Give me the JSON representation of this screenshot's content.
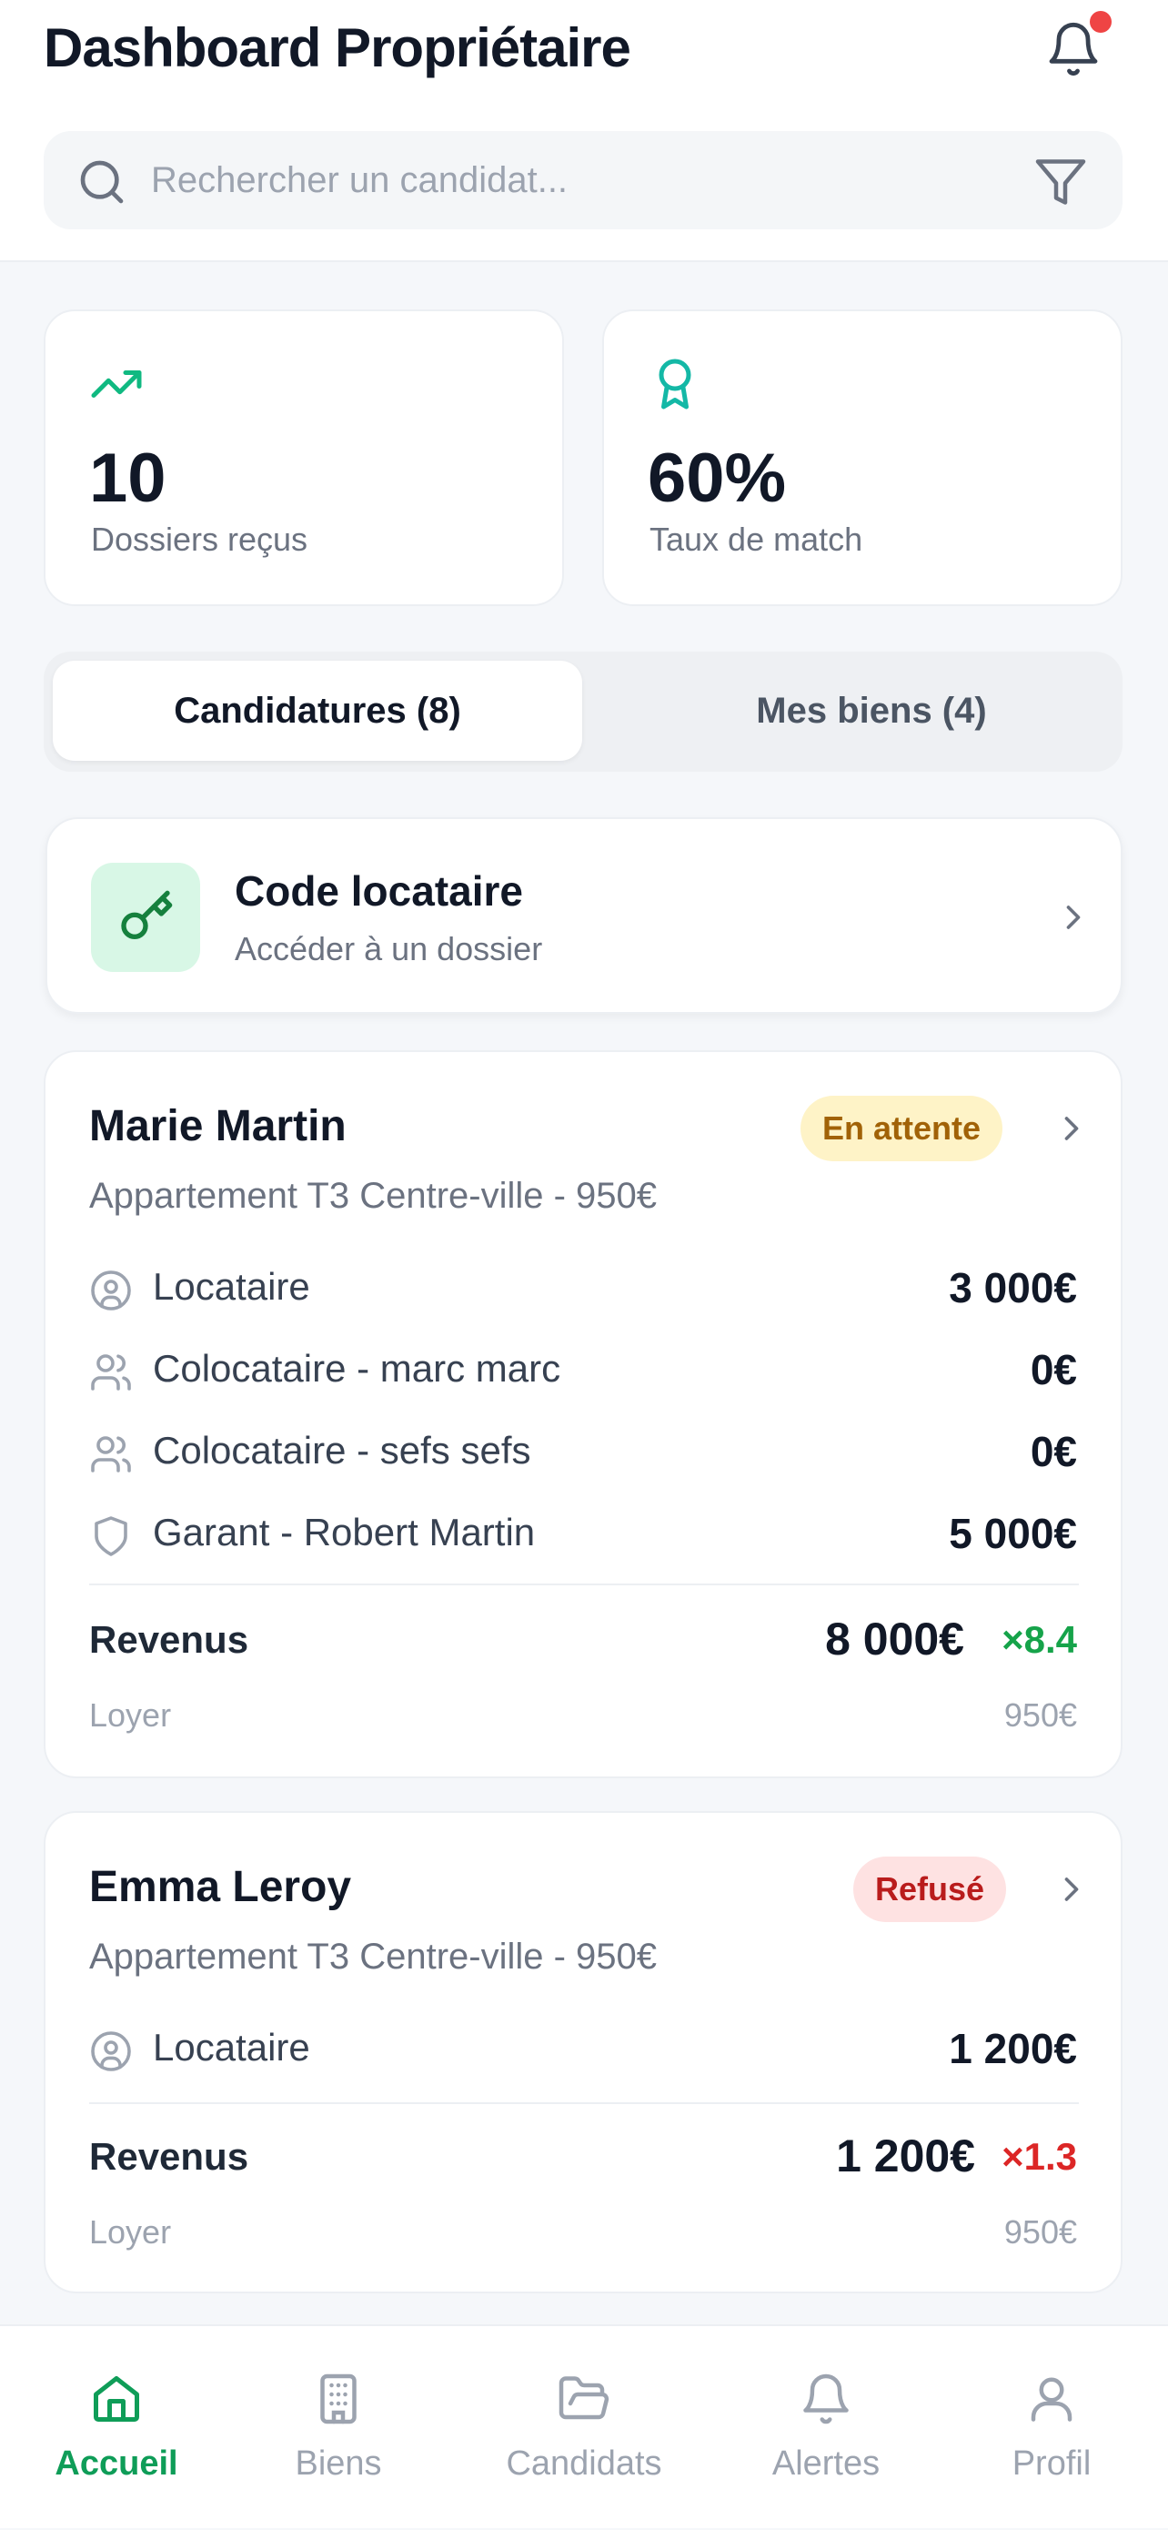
{
  "header": {
    "title": "Dashboard Propriétaire",
    "notification_icon": "bell-icon",
    "has_unread": true,
    "search_placeholder": "Rechercher un candidat...",
    "search_value": ""
  },
  "stats": [
    {
      "icon": "trending-up-icon",
      "value": "10",
      "label": "Dossiers reçus"
    },
    {
      "icon": "award-icon",
      "value": "60%",
      "label": "Taux de match"
    }
  ],
  "tabs": [
    {
      "label": "Candidatures (8)",
      "active": true
    },
    {
      "label": "Mes biens (4)",
      "active": false
    }
  ],
  "code_card": {
    "icon": "key-icon",
    "title": "Code locataire",
    "subtitle": "Accéder à un dossier"
  },
  "candidates": [
    {
      "name": "Marie Martin",
      "status": "En attente",
      "property": "Appartement T3 Centre-ville - 950€",
      "rows": [
        {
          "icon": "user-circle-icon",
          "label": "Locataire",
          "amount": "3 000€"
        },
        {
          "icon": "users-icon",
          "label": "Colocataire - marc marc",
          "amount": "0€"
        },
        {
          "icon": "users-icon",
          "label": "Colocataire - sefs sefs",
          "amount": "0€"
        },
        {
          "icon": "shield-icon",
          "label": "Garant - Robert Martin",
          "amount": "5 000€"
        }
      ],
      "revenus_label": "Revenus",
      "revenus_total": "8 000€",
      "multiplier": "×8.4",
      "loyer_label": "Loyer",
      "loyer": "950€"
    },
    {
      "name": "Emma Leroy",
      "status": "Refusé",
      "property": "Appartement T3 Centre-ville - 950€",
      "rows": [
        {
          "icon": "user-circle-icon",
          "label": "Locataire",
          "amount": "1 200€"
        }
      ],
      "revenus_label": "Revenus",
      "revenus_total": "1 200€",
      "multiplier": "×1.3",
      "loyer_label": "Loyer",
      "loyer": "950€"
    }
  ],
  "bottom_nav": [
    {
      "icon": "home-icon",
      "label": "Accueil",
      "active": true
    },
    {
      "icon": "building-icon",
      "label": "Biens",
      "active": false
    },
    {
      "icon": "folder-open-icon",
      "label": "Candidats",
      "active": false
    },
    {
      "icon": "bell-icon",
      "label": "Alertes",
      "active": false
    },
    {
      "icon": "user-icon",
      "label": "Profil",
      "active": false
    }
  ],
  "colors": {
    "accent": "#0f9d58",
    "notification_dot": "#ef4444",
    "pending_bg": "#fef3c7",
    "pending_text": "#a16207",
    "refused_bg": "#fee2e2",
    "refused_text": "#b91c1c",
    "good_ratio": "#16a34a",
    "bad_ratio": "#dc2626"
  }
}
